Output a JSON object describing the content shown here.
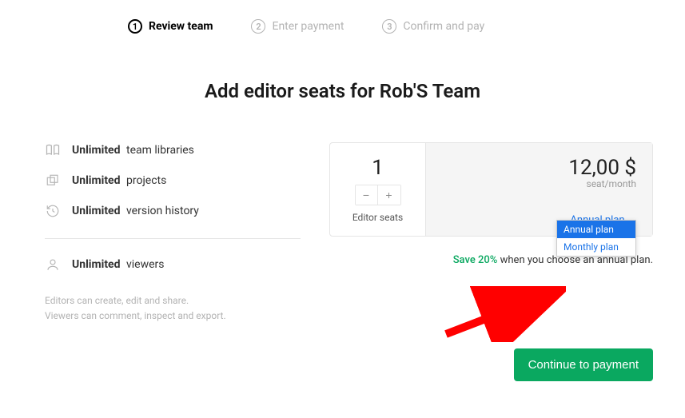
{
  "stepper": {
    "steps": [
      {
        "num": "1",
        "label": "Review team"
      },
      {
        "num": "2",
        "label": "Enter payment"
      },
      {
        "num": "3",
        "label": "Confirm and pay"
      }
    ]
  },
  "title": "Add editor seats for Rob'S Team",
  "features": {
    "items": [
      {
        "strong": "Unlimited",
        "label": "team libraries"
      },
      {
        "strong": "Unlimited",
        "label": "projects"
      },
      {
        "strong": "Unlimited",
        "label": "version history"
      }
    ],
    "viewers": {
      "strong": "Unlimited",
      "label": "viewers"
    }
  },
  "footnote": {
    "line1": "Editors can create, edit and share.",
    "line2": "Viewers can comment, inspect and export."
  },
  "pricing": {
    "qty": "1",
    "qty_label": "Editor seats",
    "price": "12,00 $",
    "price_sub": "seat/month",
    "plan_selected": "Annual plan",
    "dropdown": {
      "opt1": "Annual plan",
      "opt2": "Monthly plan"
    }
  },
  "save_line": {
    "pct": "Save 20%",
    "rest": " when you choose an annual plan."
  },
  "cta": "Continue to payment"
}
